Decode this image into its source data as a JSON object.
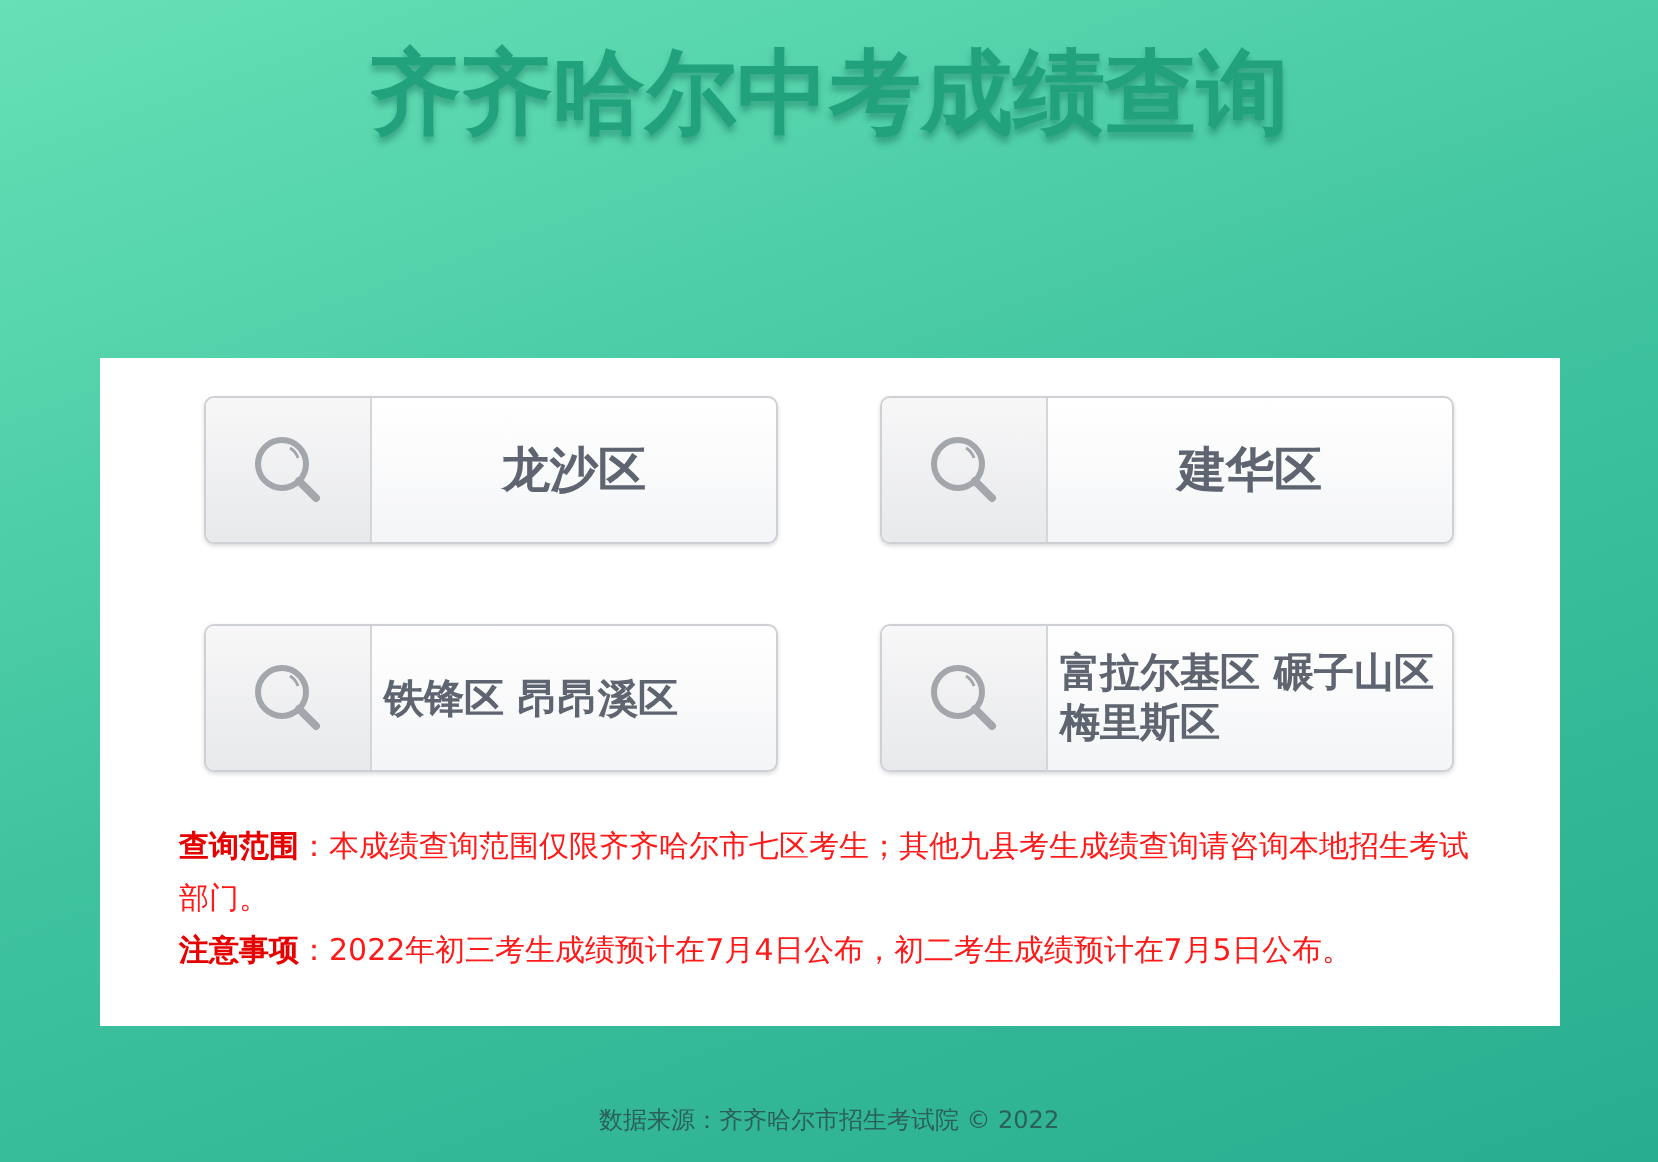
{
  "title": "齐齐哈尔中考成绩查询",
  "districts": [
    {
      "label": "龙沙区"
    },
    {
      "label": "建华区"
    },
    {
      "label": "铁锋区 昂昂溪区"
    },
    {
      "label": "富拉尔基区 碾子山区梅里斯区"
    }
  ],
  "notes": [
    "**查询范围**：本成绩查询范围仅限齐齐哈尔市七区考生；其他九县考生成绩查询请咨询本地招生考试部门。",
    "**注意事项**：2022年初三考生成绩预计在7月4日公布，初二考生成绩预计在7月5日公布。"
  ],
  "footer": "数据来源：齐齐哈尔市招生考试院 © 2022"
}
